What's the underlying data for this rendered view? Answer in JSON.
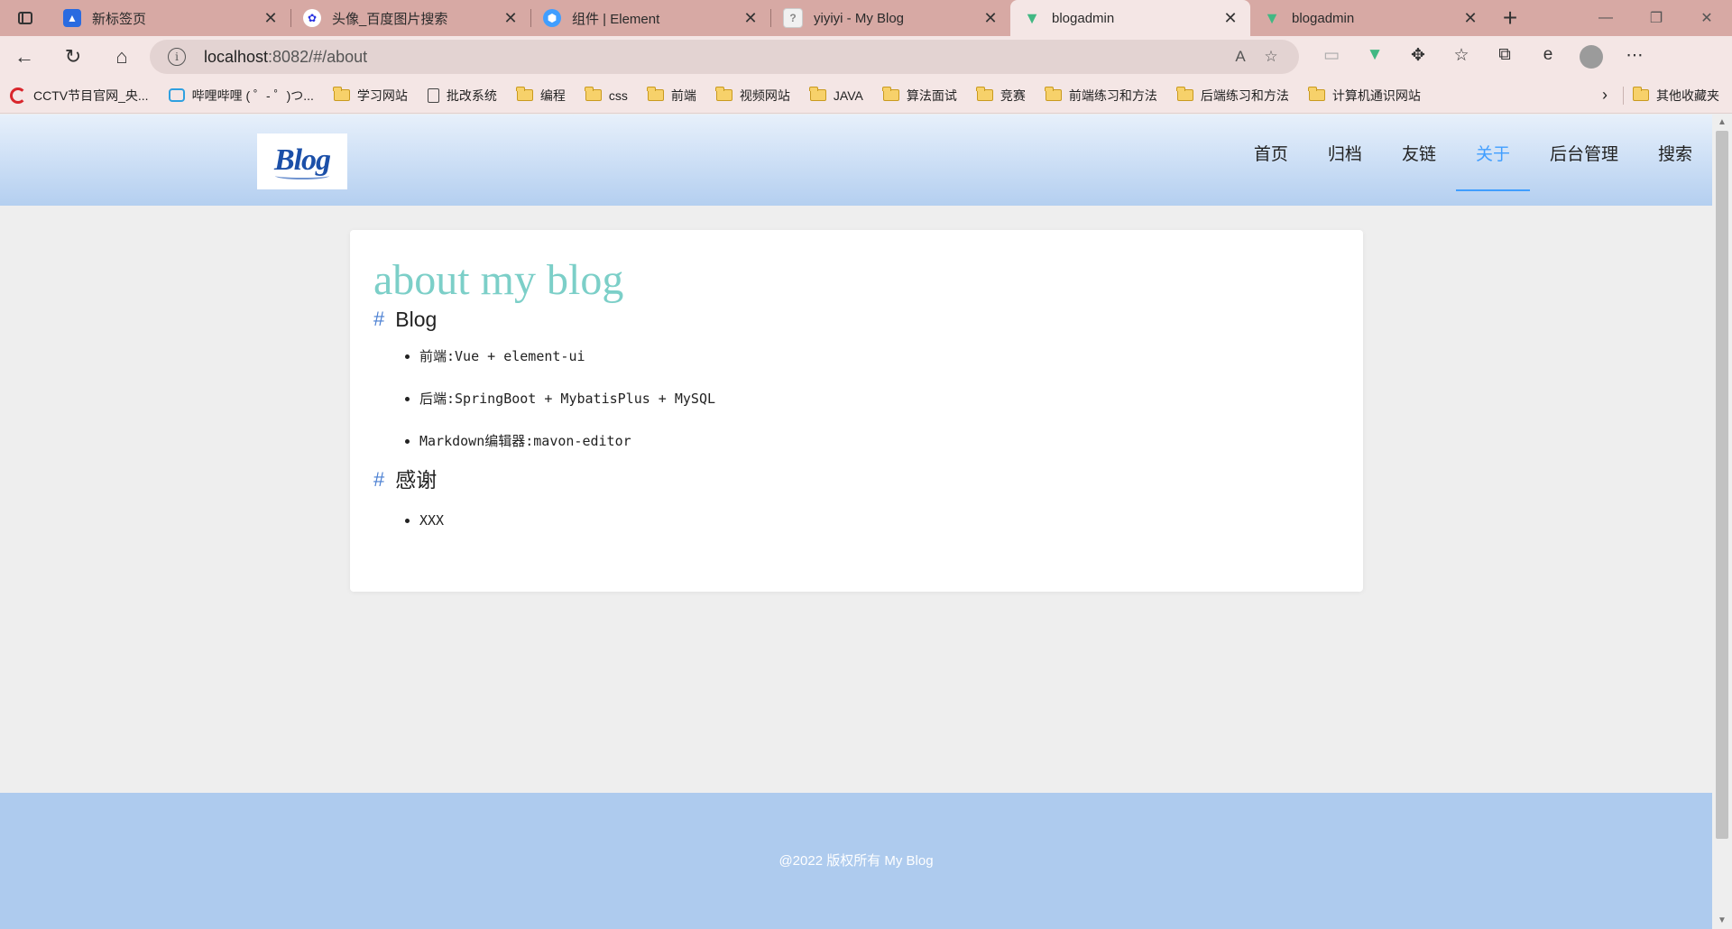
{
  "browser": {
    "tabs": [
      {
        "title": "新标签页",
        "icon": "new-tab-page-icon"
      },
      {
        "title": "头像_百度图片搜索",
        "icon": "baidu-paw-icon"
      },
      {
        "title": "组件 | Element",
        "icon": "element-logo-icon"
      },
      {
        "title": "yiyiyi - My Blog",
        "icon": "blank-page-icon"
      },
      {
        "title": "blogadmin",
        "icon": "vue-logo-icon",
        "active": true
      },
      {
        "title": "blogadmin",
        "icon": "vue-logo-icon"
      }
    ],
    "address": {
      "host": "localhost",
      "path": ":8082/#/about"
    },
    "bookmarks": [
      {
        "label": "CCTV节目官网_央...",
        "icon": "cctv-icon"
      },
      {
        "label": "哔哩哔哩 ( ゜- ゜)つ...",
        "icon": "bilibili-icon"
      },
      {
        "label": "学习网站",
        "icon": "folder-icon"
      },
      {
        "label": "批改系统",
        "icon": "page-icon"
      },
      {
        "label": "编程",
        "icon": "folder-icon"
      },
      {
        "label": "css",
        "icon": "folder-icon"
      },
      {
        "label": "前端",
        "icon": "folder-icon"
      },
      {
        "label": "视频网站",
        "icon": "folder-icon"
      },
      {
        "label": "JAVA",
        "icon": "folder-icon"
      },
      {
        "label": "算法面试",
        "icon": "folder-icon"
      },
      {
        "label": "竞赛",
        "icon": "folder-icon"
      },
      {
        "label": "前端练习和方法",
        "icon": "folder-icon"
      },
      {
        "label": "后端练习和方法",
        "icon": "folder-icon"
      },
      {
        "label": "计算机通识网站",
        "icon": "folder-icon"
      }
    ],
    "other_bookmarks": "其他收藏夹"
  },
  "site": {
    "logo_text": "Blog",
    "menu": [
      "首页",
      "归档",
      "友链",
      "关于",
      "后台管理",
      "搜索"
    ],
    "active_menu": "关于",
    "accent_color": "#409eff"
  },
  "about": {
    "title": "about my blog",
    "section1": {
      "hash": "#",
      "heading": "Blog",
      "items": [
        "前端:Vue + element-ui",
        "后端:SpringBoot + MybatisPlus + MySQL",
        "Markdown编辑器:mavon-editor"
      ]
    },
    "section2": {
      "hash": "#",
      "heading": "感谢",
      "items": [
        "XXX"
      ]
    }
  },
  "footer": {
    "text": "@2022  版权所有 My Blog"
  }
}
